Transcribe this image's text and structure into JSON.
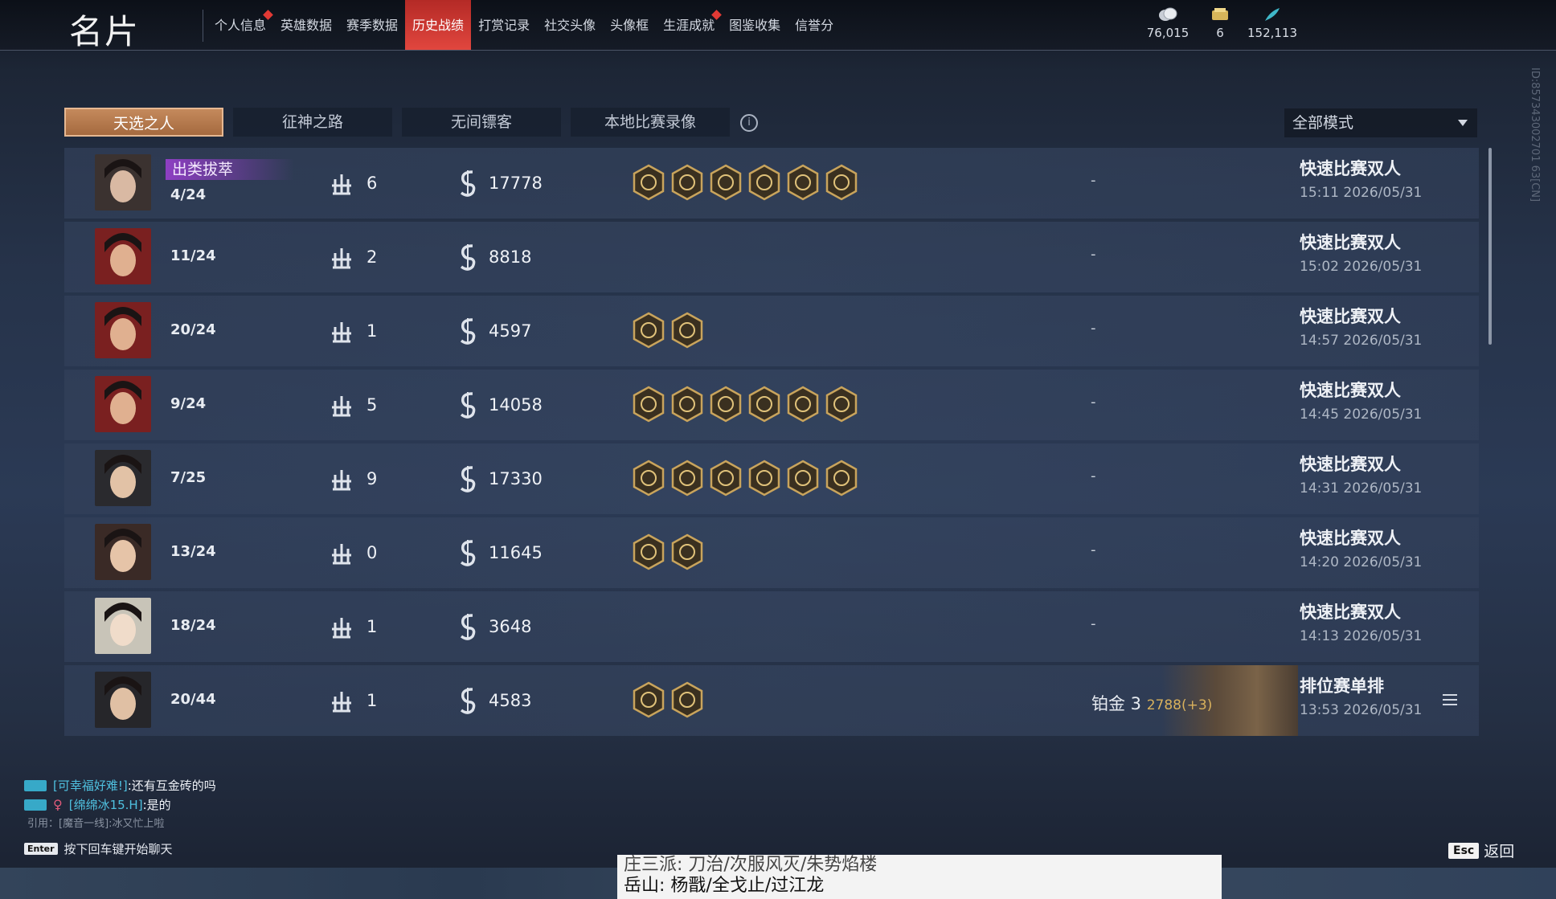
{
  "header": {
    "title": "名片",
    "nav": [
      {
        "label": "个人信息",
        "dot": true
      },
      {
        "label": "英雄数据",
        "dot": false
      },
      {
        "label": "赛季数据",
        "dot": false
      },
      {
        "label": "历史战绩",
        "dot": false,
        "active": true
      },
      {
        "label": "打赏记录",
        "dot": false
      },
      {
        "label": "社交头像",
        "dot": false
      },
      {
        "label": "头像框",
        "dot": false
      },
      {
        "label": "生涯成就",
        "dot": true
      },
      {
        "label": "图鉴收集",
        "dot": false
      },
      {
        "label": "信誉分",
        "dot": false
      }
    ],
    "currencies": [
      {
        "icon": "coin-icon",
        "value": "76,015"
      },
      {
        "icon": "ticket-icon",
        "value": "6"
      },
      {
        "icon": "feather-icon",
        "value": "152,113"
      }
    ]
  },
  "tabs": [
    "天选之人",
    "征神之路",
    "无间镖客",
    "本地比赛录像"
  ],
  "mode_select": "全部模式",
  "side_id": "ID:857343002701 63[CN]",
  "rows": [
    {
      "title": "出类拔萃",
      "rank": "4/24",
      "kills": "6",
      "damage": "17778",
      "badges": 6,
      "extra": "-",
      "mode": "快速比赛双人",
      "time": "15:11  2026/05/31"
    },
    {
      "title": "",
      "rank": "11/24",
      "kills": "2",
      "damage": "8818",
      "badges": 0,
      "extra": "-",
      "mode": "快速比赛双人",
      "time": "15:02  2026/05/31"
    },
    {
      "title": "",
      "rank": "20/24",
      "kills": "1",
      "damage": "4597",
      "badges": 2,
      "extra": "-",
      "mode": "快速比赛双人",
      "time": "14:57  2026/05/31"
    },
    {
      "title": "",
      "rank": "9/24",
      "kills": "5",
      "damage": "14058",
      "badges": 6,
      "extra": "-",
      "mode": "快速比赛双人",
      "time": "14:45  2026/05/31"
    },
    {
      "title": "",
      "rank": "7/25",
      "kills": "9",
      "damage": "17330",
      "badges": 6,
      "extra": "-",
      "mode": "快速比赛双人",
      "time": "14:31  2026/05/31"
    },
    {
      "title": "",
      "rank": "13/24",
      "kills": "0",
      "damage": "11645",
      "badges": 2,
      "extra": "-",
      "mode": "快速比赛双人",
      "time": "14:20  2026/05/31"
    },
    {
      "title": "",
      "rank": "18/24",
      "kills": "1",
      "damage": "3648",
      "badges": 0,
      "extra": "-",
      "mode": "快速比赛双人",
      "time": "14:13  2026/05/31"
    },
    {
      "title": "",
      "rank": "20/44",
      "kills": "1",
      "damage": "4583",
      "badges": 2,
      "extra": "",
      "tier": "铂金 3",
      "tier_points": "2788(+3)",
      "mode": "排位赛单排",
      "time": "13:53  2026/05/31"
    }
  ],
  "chat": {
    "lines": [
      {
        "nick": "[可幸福好难!]",
        "msg": ":还有互金砖的吗"
      },
      {
        "nick": "[绵绵冰15.H]",
        "msg": ":是的"
      }
    ],
    "quote": "引用：[魔音一线]:冰又忙上啦",
    "enter_key": "Enter",
    "enter_hint": "按下回车键开始聊天"
  },
  "esc": {
    "key": "Esc",
    "label": "返回"
  },
  "bottom_text": {
    "line1": "庄三派: 刀治/次服风灭/朱势焰楼",
    "line2": "岳山: 杨戬/全戈止/过江龙"
  }
}
